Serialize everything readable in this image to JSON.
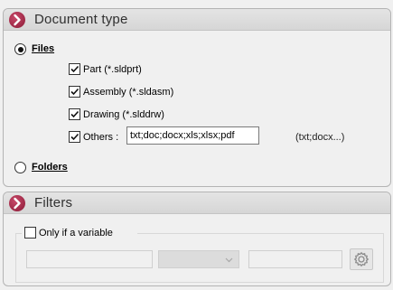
{
  "document_type": {
    "title": "Document type",
    "files_label": "Files",
    "folders_label": "Folders",
    "selected": "Files",
    "options": [
      {
        "label": "Part (*.sldprt)",
        "checked": true
      },
      {
        "label": "Assembly (*.sldasm)",
        "checked": true
      },
      {
        "label": "Drawing (*.slddrw)",
        "checked": true
      }
    ],
    "others": {
      "label": "Others :",
      "checked": true,
      "value": "txt;doc;docx;xls;xlsx;pdf",
      "hint": "(txt;docx...)"
    }
  },
  "filters": {
    "title": "Filters",
    "only_variable_label": "Only if a variable",
    "only_variable_checked": false,
    "variable_name_value": "",
    "operator_value": "",
    "variable_value": ""
  },
  "icons": {
    "header_icon": "chevron-right-icon",
    "settings_icon": "gear-icon"
  },
  "colors": {
    "accent": "#a0203f"
  }
}
